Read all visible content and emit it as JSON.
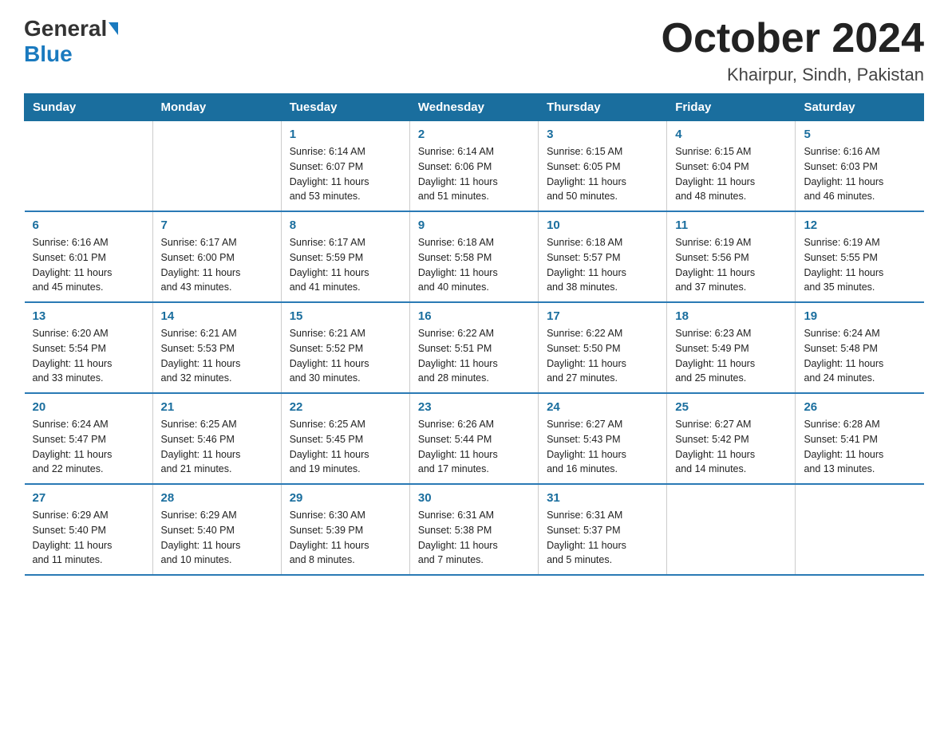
{
  "header": {
    "logo_general": "General",
    "logo_blue": "Blue",
    "month_year": "October 2024",
    "location": "Khairpur, Sindh, Pakistan"
  },
  "weekdays": [
    "Sunday",
    "Monday",
    "Tuesday",
    "Wednesday",
    "Thursday",
    "Friday",
    "Saturday"
  ],
  "weeks": [
    [
      {
        "day": "",
        "info": ""
      },
      {
        "day": "",
        "info": ""
      },
      {
        "day": "1",
        "info": "Sunrise: 6:14 AM\nSunset: 6:07 PM\nDaylight: 11 hours\nand 53 minutes."
      },
      {
        "day": "2",
        "info": "Sunrise: 6:14 AM\nSunset: 6:06 PM\nDaylight: 11 hours\nand 51 minutes."
      },
      {
        "day": "3",
        "info": "Sunrise: 6:15 AM\nSunset: 6:05 PM\nDaylight: 11 hours\nand 50 minutes."
      },
      {
        "day": "4",
        "info": "Sunrise: 6:15 AM\nSunset: 6:04 PM\nDaylight: 11 hours\nand 48 minutes."
      },
      {
        "day": "5",
        "info": "Sunrise: 6:16 AM\nSunset: 6:03 PM\nDaylight: 11 hours\nand 46 minutes."
      }
    ],
    [
      {
        "day": "6",
        "info": "Sunrise: 6:16 AM\nSunset: 6:01 PM\nDaylight: 11 hours\nand 45 minutes."
      },
      {
        "day": "7",
        "info": "Sunrise: 6:17 AM\nSunset: 6:00 PM\nDaylight: 11 hours\nand 43 minutes."
      },
      {
        "day": "8",
        "info": "Sunrise: 6:17 AM\nSunset: 5:59 PM\nDaylight: 11 hours\nand 41 minutes."
      },
      {
        "day": "9",
        "info": "Sunrise: 6:18 AM\nSunset: 5:58 PM\nDaylight: 11 hours\nand 40 minutes."
      },
      {
        "day": "10",
        "info": "Sunrise: 6:18 AM\nSunset: 5:57 PM\nDaylight: 11 hours\nand 38 minutes."
      },
      {
        "day": "11",
        "info": "Sunrise: 6:19 AM\nSunset: 5:56 PM\nDaylight: 11 hours\nand 37 minutes."
      },
      {
        "day": "12",
        "info": "Sunrise: 6:19 AM\nSunset: 5:55 PM\nDaylight: 11 hours\nand 35 minutes."
      }
    ],
    [
      {
        "day": "13",
        "info": "Sunrise: 6:20 AM\nSunset: 5:54 PM\nDaylight: 11 hours\nand 33 minutes."
      },
      {
        "day": "14",
        "info": "Sunrise: 6:21 AM\nSunset: 5:53 PM\nDaylight: 11 hours\nand 32 minutes."
      },
      {
        "day": "15",
        "info": "Sunrise: 6:21 AM\nSunset: 5:52 PM\nDaylight: 11 hours\nand 30 minutes."
      },
      {
        "day": "16",
        "info": "Sunrise: 6:22 AM\nSunset: 5:51 PM\nDaylight: 11 hours\nand 28 minutes."
      },
      {
        "day": "17",
        "info": "Sunrise: 6:22 AM\nSunset: 5:50 PM\nDaylight: 11 hours\nand 27 minutes."
      },
      {
        "day": "18",
        "info": "Sunrise: 6:23 AM\nSunset: 5:49 PM\nDaylight: 11 hours\nand 25 minutes."
      },
      {
        "day": "19",
        "info": "Sunrise: 6:24 AM\nSunset: 5:48 PM\nDaylight: 11 hours\nand 24 minutes."
      }
    ],
    [
      {
        "day": "20",
        "info": "Sunrise: 6:24 AM\nSunset: 5:47 PM\nDaylight: 11 hours\nand 22 minutes."
      },
      {
        "day": "21",
        "info": "Sunrise: 6:25 AM\nSunset: 5:46 PM\nDaylight: 11 hours\nand 21 minutes."
      },
      {
        "day": "22",
        "info": "Sunrise: 6:25 AM\nSunset: 5:45 PM\nDaylight: 11 hours\nand 19 minutes."
      },
      {
        "day": "23",
        "info": "Sunrise: 6:26 AM\nSunset: 5:44 PM\nDaylight: 11 hours\nand 17 minutes."
      },
      {
        "day": "24",
        "info": "Sunrise: 6:27 AM\nSunset: 5:43 PM\nDaylight: 11 hours\nand 16 minutes."
      },
      {
        "day": "25",
        "info": "Sunrise: 6:27 AM\nSunset: 5:42 PM\nDaylight: 11 hours\nand 14 minutes."
      },
      {
        "day": "26",
        "info": "Sunrise: 6:28 AM\nSunset: 5:41 PM\nDaylight: 11 hours\nand 13 minutes."
      }
    ],
    [
      {
        "day": "27",
        "info": "Sunrise: 6:29 AM\nSunset: 5:40 PM\nDaylight: 11 hours\nand 11 minutes."
      },
      {
        "day": "28",
        "info": "Sunrise: 6:29 AM\nSunset: 5:40 PM\nDaylight: 11 hours\nand 10 minutes."
      },
      {
        "day": "29",
        "info": "Sunrise: 6:30 AM\nSunset: 5:39 PM\nDaylight: 11 hours\nand 8 minutes."
      },
      {
        "day": "30",
        "info": "Sunrise: 6:31 AM\nSunset: 5:38 PM\nDaylight: 11 hours\nand 7 minutes."
      },
      {
        "day": "31",
        "info": "Sunrise: 6:31 AM\nSunset: 5:37 PM\nDaylight: 11 hours\nand 5 minutes."
      },
      {
        "day": "",
        "info": ""
      },
      {
        "day": "",
        "info": ""
      }
    ]
  ]
}
